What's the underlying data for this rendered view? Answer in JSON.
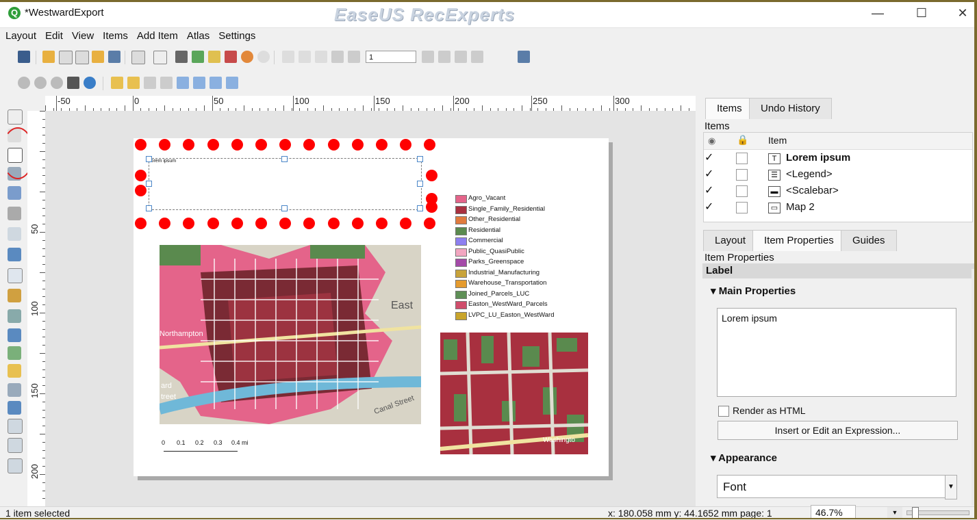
{
  "window": {
    "title": "*WestwardExport",
    "watermark": "EaseUS RecExperts",
    "app_icon": "qgis-icon"
  },
  "menu": [
    "Layout",
    "Edit",
    "View",
    "Items",
    "Add Item",
    "Atlas",
    "Settings"
  ],
  "atlas_toolbar": {
    "page_value": "1"
  },
  "rulers": {
    "h_labels": [
      "-50",
      "0",
      "50",
      "100",
      "150",
      "200",
      "250",
      "300"
    ],
    "v_labels": [
      "50",
      "100",
      "150",
      "200"
    ]
  },
  "layout_page": {
    "label_text": "lorem ipsum",
    "legend": [
      {
        "label": "Agro_Vacant",
        "color": "#e4648a"
      },
      {
        "label": "Single_Family_Residential",
        "color": "#a8303f"
      },
      {
        "label": "Other_Residential",
        "color": "#e07b3e"
      },
      {
        "label": "Residential",
        "color": "#5a8a4e"
      },
      {
        "label": "Commercial",
        "color": "#8d7ff0"
      },
      {
        "label": "Public_QuasiPublic",
        "color": "#f2a6c0"
      },
      {
        "label": "Parks_Greenspace",
        "color": "#a44aa8"
      },
      {
        "label": "Industrial_Manufacturing",
        "color": "#c8a33a"
      },
      {
        "label": "Warehouse_Transportation",
        "color": "#e59b2e"
      },
      {
        "label": "Joined_Parcels_LUC",
        "color": "#5e8f56"
      },
      {
        "label": "Easton_WestWard_Parcels",
        "color": "#cf4d6b"
      },
      {
        "label": "LVPC_LU_Easton_WestWard",
        "color": "#c9a52c"
      }
    ],
    "map_labels": {
      "east": "East",
      "northampton": "Northampton",
      "canal": "Canal Street",
      "washington": "Washingto",
      "street": "treet",
      "ward": "ard"
    },
    "scalebar": {
      "ticks": [
        "0",
        "0.1",
        "0.2",
        "0.3",
        "0.4 mi"
      ]
    }
  },
  "items_panel": {
    "tabs": [
      "Items",
      "Undo History"
    ],
    "header": "Items",
    "column_item": "Item",
    "rows": [
      {
        "name": "Lorem ipsum",
        "checked": "✓",
        "icon": "T",
        "bold": true
      },
      {
        "name": "<Legend>",
        "checked": "✓",
        "icon": "☰"
      },
      {
        "name": "<Scalebar>",
        "checked": "✓",
        "icon": "▬"
      },
      {
        "name": "Map 2",
        "checked": "✓",
        "icon": "▭"
      }
    ]
  },
  "props_panel": {
    "tabs": [
      "Layout",
      "Item Properties",
      "Guides"
    ],
    "header": "Item Properties",
    "section": "Label",
    "main_properties": "Main Properties",
    "label_value": "Lorem ipsum",
    "render_html": "Render as HTML",
    "insert_expression": "Insert or Edit an Expression...",
    "appearance": "Appearance",
    "font_button": "Font"
  },
  "status": {
    "left": "1 item selected",
    "coords": "x: 180.058 mm y: 44.1652 mm page: 1",
    "zoom": "46.7%"
  },
  "colors": {
    "dots": "#ff0000",
    "frame": "#7a6a2e",
    "map_red": "#a8303f",
    "map_pink": "#e4648a"
  }
}
